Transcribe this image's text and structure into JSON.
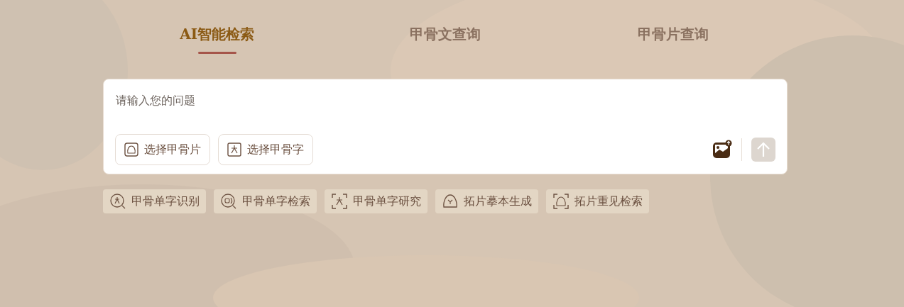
{
  "tabs": [
    {
      "label": "AI智能检索",
      "selected": true
    },
    {
      "label": "甲骨文查询",
      "selected": false
    },
    {
      "label": "甲骨片查询",
      "selected": false
    }
  ],
  "search": {
    "placeholder": "请输入您的问题",
    "pickers": [
      {
        "label": "选择甲骨片",
        "kind": "fragment"
      },
      {
        "label": "选择甲骨字",
        "kind": "glyph"
      }
    ],
    "send_disabled": true
  },
  "actions": [
    {
      "label": "甲骨单字识别",
      "kind": "recognize"
    },
    {
      "label": "甲骨单字检索",
      "kind": "search"
    },
    {
      "label": "甲骨单字研究",
      "kind": "study"
    },
    {
      "label": "拓片摹本生成",
      "kind": "generate"
    },
    {
      "label": "拓片重见检索",
      "kind": "rubbing-search"
    }
  ]
}
